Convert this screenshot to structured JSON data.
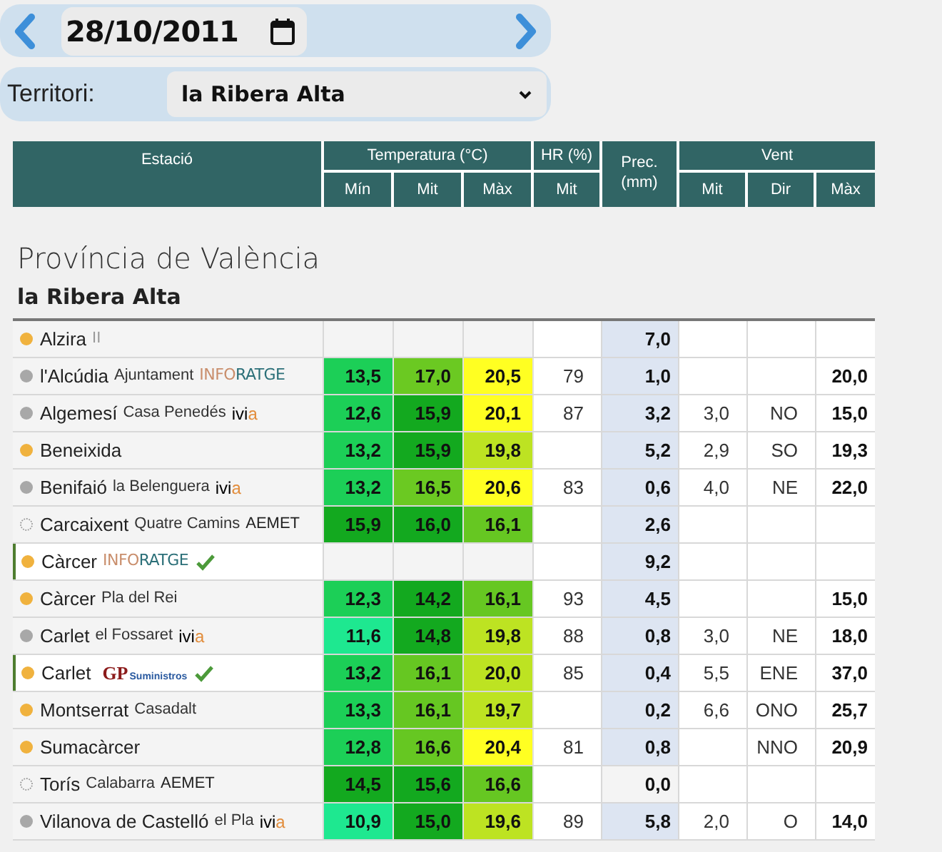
{
  "date_picker": {
    "value": "28/10/2011"
  },
  "territory": {
    "label": "Territori:",
    "value": "la Ribera Alta"
  },
  "table": {
    "header_groups": [
      {
        "label": "Estació"
      },
      {
        "label": "Temperatura (°C)",
        "subheaders": [
          "Mín",
          "Mit",
          "Màx"
        ]
      },
      {
        "label": "HR (%)",
        "subheaders": [
          "Mit"
        ]
      },
      {
        "label": "Prec. (mm)"
      },
      {
        "label": "Vent",
        "subheaders": [
          "Mit",
          "Dir",
          "Màx"
        ]
      }
    ]
  },
  "province": "Província de València",
  "region": "la Ribera Alta",
  "rows": [
    {
      "dot": {
        "kind": "filled",
        "color": "#f0b23e"
      },
      "name": "Alzira",
      "network": {
        "kind": "roman",
        "parts": [
          "II"
        ]
      },
      "verified": false,
      "prec": "7,0",
      "prec_valid": true
    },
    {
      "dot": {
        "kind": "filled",
        "color": "#a8a8a8"
      },
      "name": "l'Alcúdia",
      "place": "Ajuntament",
      "network": {
        "kind": "inforatge",
        "parts": [
          "INFO",
          "RATGE"
        ]
      },
      "verified": false,
      "min": {
        "value": "13,5",
        "color": "#1ccf57"
      },
      "mit": {
        "value": "17,0",
        "color": "#6bc922"
      },
      "max": {
        "value": "20,5",
        "color": "#ffff22"
      },
      "hr": "79",
      "prec": "1,0",
      "prec_valid": true,
      "wind_max": "20,0"
    },
    {
      "dot": {
        "kind": "filled",
        "color": "#a8a8a8"
      },
      "name": "Algemesí",
      "place": "Casa Penedés",
      "network": {
        "kind": "ivia",
        "parts": [
          "ivi",
          "a"
        ]
      },
      "verified": false,
      "min": {
        "value": "12,6",
        "color": "#1ccf57"
      },
      "mit": {
        "value": "15,9",
        "color": "#13a91f"
      },
      "max": {
        "value": "20,1",
        "color": "#ffff22"
      },
      "hr": "87",
      "prec": "3,2",
      "prec_valid": true,
      "wind_mit": "3,0",
      "wind_dir": "NO",
      "wind_max": "15,0"
    },
    {
      "dot": {
        "kind": "filled",
        "color": "#f0b23e"
      },
      "name": "Beneixida",
      "verified": false,
      "min": {
        "value": "13,2",
        "color": "#1ccf57"
      },
      "mit": {
        "value": "15,9",
        "color": "#13a91f"
      },
      "max": {
        "value": "19,8",
        "color": "#bde322"
      },
      "prec": "5,2",
      "prec_valid": true,
      "wind_mit": "2,9",
      "wind_dir": "SO",
      "wind_max": "19,3"
    },
    {
      "dot": {
        "kind": "filled",
        "color": "#a8a8a8"
      },
      "name": "Benifaió",
      "place": "la Belenguera",
      "network": {
        "kind": "ivia",
        "parts": [
          "ivi",
          "a"
        ]
      },
      "verified": false,
      "min": {
        "value": "13,2",
        "color": "#1ccf57"
      },
      "mit": {
        "value": "16,5",
        "color": "#6bc922"
      },
      "max": {
        "value": "20,6",
        "color": "#ffff22"
      },
      "hr": "83",
      "prec": "0,6",
      "prec_valid": true,
      "wind_mit": "4,0",
      "wind_dir": "NE",
      "wind_max": "22,0"
    },
    {
      "dot": {
        "kind": "dashed"
      },
      "name": "Carcaixent",
      "place": "Quatre Camins",
      "network": {
        "kind": "aemet",
        "parts": [
          "AEMET"
        ]
      },
      "verified": false,
      "min": {
        "value": "15,9",
        "color": "#13a91f"
      },
      "mit": {
        "value": "16,0",
        "color": "#13a91f"
      },
      "max": {
        "value": "16,1",
        "color": "#66c722"
      },
      "prec": "2,6",
      "prec_valid": true
    },
    {
      "dot": {
        "kind": "filled",
        "color": "#f0b23e"
      },
      "name": "Càrcer",
      "network": {
        "kind": "inforatge",
        "parts": [
          "INFO",
          "RATGE"
        ]
      },
      "verified": true,
      "prec": "9,2",
      "prec_valid": true
    },
    {
      "dot": {
        "kind": "filled",
        "color": "#f0b23e"
      },
      "name": "Càrcer",
      "place": "Pla del Rei",
      "verified": false,
      "min": {
        "value": "12,3",
        "color": "#1ccf57"
      },
      "mit": {
        "value": "14,2",
        "color": "#13a91f"
      },
      "max": {
        "value": "16,1",
        "color": "#66c722"
      },
      "hr": "93",
      "prec": "4,5",
      "prec_valid": true,
      "wind_max": "15,0"
    },
    {
      "dot": {
        "kind": "filled",
        "color": "#a8a8a8"
      },
      "name": "Carlet",
      "place": "el Fossaret",
      "network": {
        "kind": "ivia",
        "parts": [
          "ivi",
          "a"
        ]
      },
      "verified": false,
      "min": {
        "value": "11,6",
        "color": "#1ee890"
      },
      "mit": {
        "value": "14,8",
        "color": "#13a91f"
      },
      "max": {
        "value": "19,8",
        "color": "#bde322"
      },
      "hr": "88",
      "prec": "0,8",
      "prec_valid": true,
      "wind_mit": "3,0",
      "wind_dir": "NE",
      "wind_max": "18,0"
    },
    {
      "dot": {
        "kind": "filled",
        "color": "#f0b23e"
      },
      "name": "Carlet",
      "network": {
        "kind": "gp",
        "parts": [
          "GP",
          "Suministros"
        ]
      },
      "verified": true,
      "min": {
        "value": "13,2",
        "color": "#1ccf57"
      },
      "mit": {
        "value": "16,1",
        "color": "#66c722"
      },
      "max": {
        "value": "20,0",
        "color": "#bde322"
      },
      "hr": "85",
      "prec": "0,4",
      "prec_valid": true,
      "wind_mit": "5,5",
      "wind_dir": "ENE",
      "wind_max": "37,0"
    },
    {
      "dot": {
        "kind": "filled",
        "color": "#f0b23e"
      },
      "name": "Montserrat",
      "place": "Casadalt",
      "verified": false,
      "min": {
        "value": "13,3",
        "color": "#1ccf57"
      },
      "mit": {
        "value": "16,1",
        "color": "#66c722"
      },
      "max": {
        "value": "19,7",
        "color": "#bde322"
      },
      "prec": "0,2",
      "prec_valid": true,
      "wind_mit": "6,6",
      "wind_dir": "ONO",
      "wind_max": "25,7"
    },
    {
      "dot": {
        "kind": "filled",
        "color": "#f0b23e"
      },
      "name": "Sumacàrcer",
      "verified": false,
      "min": {
        "value": "12,8",
        "color": "#1ccf57"
      },
      "mit": {
        "value": "16,6",
        "color": "#66c722"
      },
      "max": {
        "value": "20,4",
        "color": "#ffff22"
      },
      "hr": "81",
      "prec": "0,8",
      "prec_valid": true,
      "wind_dir": "NNO",
      "wind_max": "20,9"
    },
    {
      "dot": {
        "kind": "dashed"
      },
      "name": "Torís",
      "place": "Calabarra",
      "network": {
        "kind": "aemet",
        "parts": [
          "AEMET"
        ]
      },
      "verified": false,
      "min": {
        "value": "14,5",
        "color": "#13a91f"
      },
      "mit": {
        "value": "15,6",
        "color": "#13a91f"
      },
      "max": {
        "value": "16,6",
        "color": "#66c722"
      },
      "prec": "0,0",
      "prec_valid": false
    },
    {
      "dot": {
        "kind": "filled",
        "color": "#a8a8a8"
      },
      "name": "Vilanova de Castelló",
      "place": "el Pla",
      "network": {
        "kind": "ivia",
        "parts": [
          "ivi",
          "a"
        ]
      },
      "verified": false,
      "min": {
        "value": "10,9",
        "color": "#1ee890"
      },
      "mit": {
        "value": "15,0",
        "color": "#13a91f"
      },
      "max": {
        "value": "19,6",
        "color": "#bde322"
      },
      "hr": "89",
      "prec": "5,8",
      "prec_valid": true,
      "wind_mit": "2,0",
      "wind_dir": "O",
      "wind_max": "14,0"
    }
  ]
}
